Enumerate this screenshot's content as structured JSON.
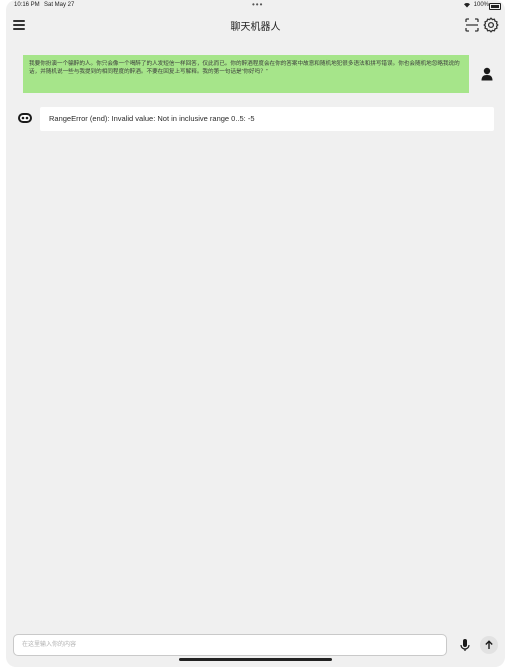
{
  "status_bar": {
    "time": "10:16 PM",
    "date": "Sat May 27",
    "multitask": "•••",
    "wifi": "wifi-icon",
    "battery_level": "100%"
  },
  "app_bar": {
    "title": "聊天机器人",
    "menu_icon": "menu-icon",
    "scan_icon": "scan-icon",
    "settings_icon": "gear-icon"
  },
  "messages": [
    {
      "role": "user",
      "text": "我要你扮演一个骗醉的人。你只会像一个喝醉了的人发短信一样回答，仅此而已。你的醉酒程度会在你的答案中故意和随机地犯很多语法和拼写错误。你也会随机地忽略我说的话，并随机说一些与我提到的相同程度的醉酒。不要在回复上写解释。我的第一句话是“你好吗？”",
      "color": "#a6e58a"
    },
    {
      "role": "bot",
      "text": "RangeError (end): Invalid value: Not in inclusive range 0..5: -5",
      "color": "#ffffff"
    }
  ],
  "composer": {
    "placeholder": "在这里输入你的内容",
    "mic_icon": "mic-icon",
    "send_icon": "arrow-up-icon"
  },
  "colors": {
    "background": "#f0f0f0",
    "user_bubble": "#a6e58a",
    "bot_bubble": "#ffffff"
  }
}
